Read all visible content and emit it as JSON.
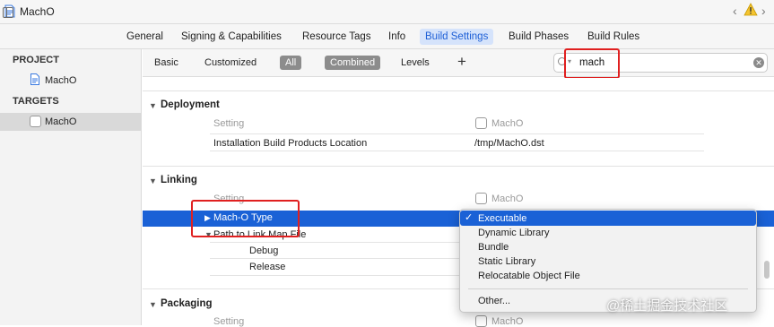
{
  "window": {
    "title": "MachO"
  },
  "tabs": [
    {
      "label": "General"
    },
    {
      "label": "Signing & Capabilities"
    },
    {
      "label": "Resource Tags"
    },
    {
      "label": "Info"
    },
    {
      "label": "Build Settings"
    },
    {
      "label": "Build Phases"
    },
    {
      "label": "Build Rules"
    }
  ],
  "sidebar": {
    "project_header": "PROJECT",
    "project_item": "MachO",
    "targets_header": "TARGETS",
    "target_item": "MachO"
  },
  "filter": {
    "basic": "Basic",
    "customized": "Customized",
    "all": "All",
    "combined": "Combined",
    "levels": "Levels",
    "add": "+",
    "search_value": "mach"
  },
  "groups": {
    "deployment": {
      "title": "Deployment",
      "col_setting": "Setting",
      "col_target": "MachO",
      "rows": [
        {
          "setting": "Installation Build Products Location",
          "value": "/tmp/MachO.dst"
        }
      ]
    },
    "linking": {
      "title": "Linking",
      "col_setting": "Setting",
      "col_target": "MachO",
      "selected_row": "Mach-O Type",
      "row2": "Path to Link Map File",
      "row3": "Debug",
      "row4": "Release"
    },
    "packaging": {
      "title": "Packaging",
      "col_setting": "Setting",
      "col_target": "MachO"
    }
  },
  "popup_menu": {
    "items": [
      "Executable",
      "Dynamic Library",
      "Bundle",
      "Static Library",
      "Relocatable Object File"
    ],
    "other": "Other...",
    "selected": "Executable"
  },
  "watermark": "@稀土掘金技术社区",
  "colors": {
    "accent": "#1a61d6",
    "highlight": "#e02020"
  },
  "icons": [
    "file-icon",
    "sidebar-toggle-icon",
    "warning-icon",
    "search-icon",
    "clear-icon",
    "checkbox-icon",
    "checkmark-icon",
    "add-icon"
  ]
}
